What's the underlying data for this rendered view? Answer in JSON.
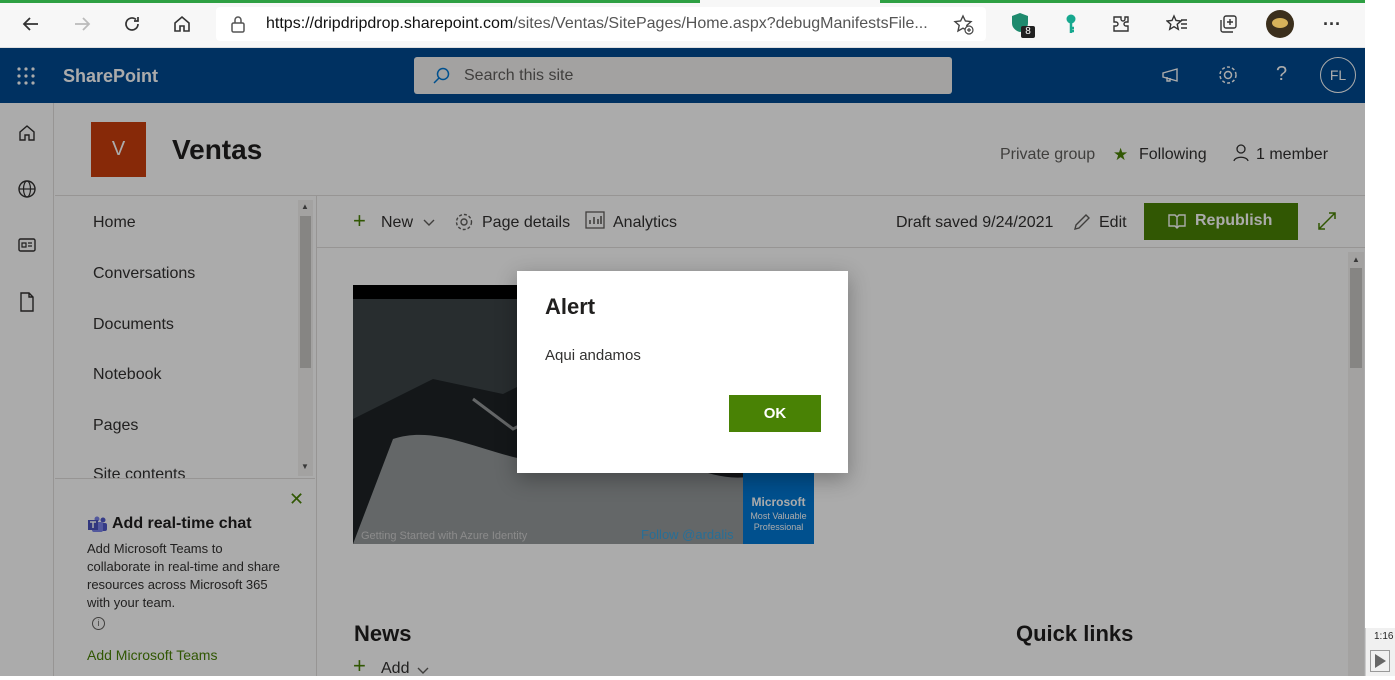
{
  "browser": {
    "url_host": "https://dripdripdrop.sharepoint.com",
    "url_path": "/sites/Ventas/SitePages/Home.aspx?debugManifestsFile...",
    "ext_badge": "8"
  },
  "suite": {
    "app_name": "SharePoint",
    "search_placeholder": "Search this site",
    "avatar_initials": "FL"
  },
  "site": {
    "logo_letter": "V",
    "title": "Ventas",
    "privacy": "Private group",
    "following": "Following",
    "members": "1 member"
  },
  "nav": {
    "items": [
      "Home",
      "Conversations",
      "Documents",
      "Notebook",
      "Pages",
      "Site contents"
    ]
  },
  "chat": {
    "title": "Add real-time chat",
    "body": "Add Microsoft Teams to collaborate in real-time and share resources across Microsoft 365 with your team.",
    "link": "Add Microsoft Teams"
  },
  "cmdbar": {
    "new": "New",
    "page_details": "Page details",
    "analytics": "Analytics",
    "draft": "Draft saved 9/24/2021",
    "edit": "Edit",
    "republish": "Republish"
  },
  "video": {
    "caption_left": "Getting Started with Azure Identity",
    "caption_right": "Follow @ardalis",
    "badge_line1": "Microsoft",
    "badge_line2": "Most Valuable",
    "badge_line3": "Professional"
  },
  "sections": {
    "news": "News",
    "add": "Add",
    "quick_links": "Quick links"
  },
  "dialog": {
    "title": "Alert",
    "message": "Aqui andamos",
    "ok": "OK"
  },
  "taskbar": {
    "time": "1:16"
  },
  "colors": {
    "suite_blue": "#004a91",
    "accent_green": "#498205",
    "logo_orange": "#ca3e0c"
  }
}
